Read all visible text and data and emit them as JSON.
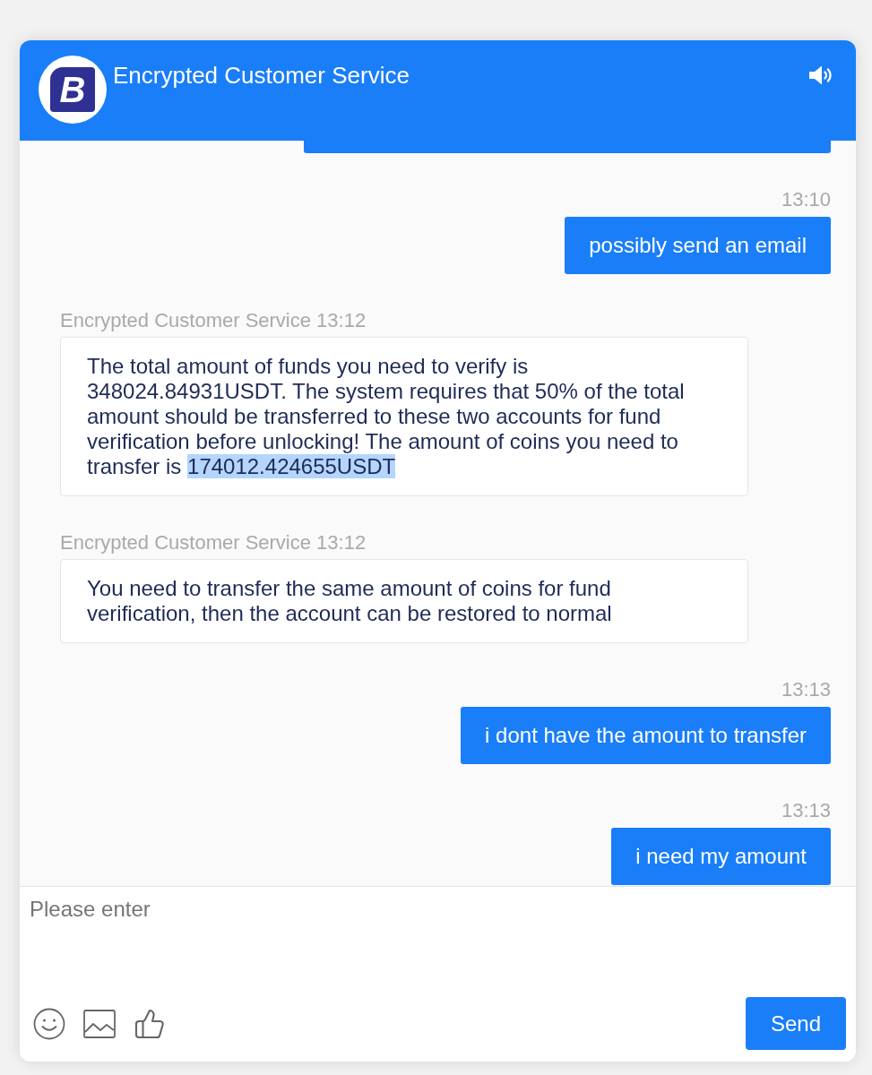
{
  "header": {
    "logo_letter": "B",
    "title": "Encrypted Customer Service"
  },
  "messages": [
    {
      "kind": "clipped_outgoing"
    },
    {
      "kind": "outgoing",
      "meta": "13:10",
      "text": "possibly send an email"
    },
    {
      "kind": "incoming",
      "meta": "Encrypted Customer Service 13:12",
      "parts": [
        {
          "text": "The total amount of funds you need to verify is 348024.84931USDT. The system requires that 50% of the total amount should be transferred to these two accounts for fund verification before unlocking! The amount of coins you need to transfer is ",
          "highlighted": false
        },
        {
          "text": "174012.424655USDT",
          "highlighted": true
        }
      ]
    },
    {
      "kind": "incoming",
      "meta": "Encrypted Customer Service 13:12",
      "parts": [
        {
          "text": "You need to transfer the same amount of coins for fund verification, then the account can be restored to normal",
          "highlighted": false
        }
      ]
    },
    {
      "kind": "outgoing",
      "meta": "13:13",
      "text": "i dont have the amount to transfer"
    },
    {
      "kind": "outgoing",
      "meta": "13:13",
      "text": "i need my amount"
    }
  ],
  "composer": {
    "placeholder": "Please enter",
    "send_label": "Send"
  }
}
